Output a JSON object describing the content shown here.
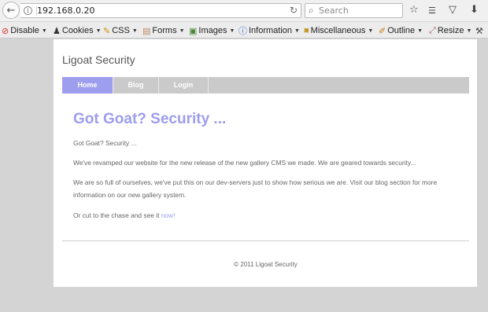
{
  "browser": {
    "url": "192.168.0.20",
    "search_placeholder": "Search"
  },
  "devbar": {
    "items": [
      {
        "label": "Disable",
        "icon": "no-sign-icon"
      },
      {
        "label": "Cookies",
        "icon": "person-icon"
      },
      {
        "label": "CSS",
        "icon": "pencil-icon"
      },
      {
        "label": "Forms",
        "icon": "clipboard-icon"
      },
      {
        "label": "Images",
        "icon": "image-icon"
      },
      {
        "label": "Information",
        "icon": "info-icon"
      },
      {
        "label": "Miscellaneous",
        "icon": "folder-icon"
      },
      {
        "label": "Outline",
        "icon": "pen-icon"
      },
      {
        "label": "Resize",
        "icon": "resize-icon"
      }
    ]
  },
  "site": {
    "title": "Ligoat Security",
    "menu": [
      {
        "label": "Home",
        "active": true
      },
      {
        "label": "Blog",
        "active": false
      },
      {
        "label": "Login",
        "active": false
      }
    ],
    "heading": "Got Goat? Security ...",
    "paragraphs": [
      "Got Goat? Security ...",
      "We've revamped our website for the new release of the new gallery CMS we made. We are geared towards security...",
      "We are so full of ourselves, we've put this on our dev-servers just to show how serious we are. Visit our blog section for more information on our new gallery system."
    ],
    "cta_text": "Or cut to the chase and see it ",
    "cta_link": "now!",
    "footer": "© 2011 Ligoat Security"
  },
  "colors": {
    "accent": "#9d9def",
    "menu_bg": "#cacaca",
    "menu_active": "#9e9eee"
  }
}
